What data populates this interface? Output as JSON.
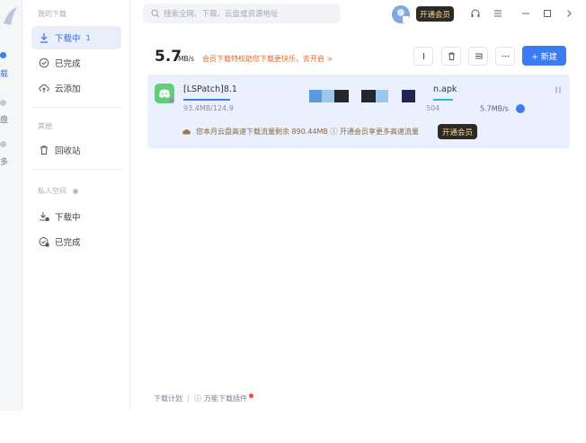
{
  "rail": {
    "items": [
      {
        "label": "载"
      },
      {
        "label": "盘"
      },
      {
        "label": "多"
      }
    ]
  },
  "sidebar": {
    "section_downloads": "我的下载",
    "items": [
      {
        "label": "下载中",
        "count": "1"
      },
      {
        "label": "已完成"
      },
      {
        "label": "云添加"
      }
    ],
    "section_trash": "其他",
    "trash_label": "回收站",
    "section_private": "私人空间",
    "private_items": [
      {
        "label": "下载中"
      },
      {
        "label": "已完成"
      }
    ]
  },
  "topbar": {
    "search_placeholder": "搜索全网、下载、云盘或资源地址",
    "vip_label": "开通会员"
  },
  "header": {
    "speed_value": "5.7",
    "speed_unit": "MB/s",
    "promo_text": "会员下载特权助您下载更快乐，去开启 >",
    "new_label": "+ 新建"
  },
  "task": {
    "name_left": "[LSPatch]8.1",
    "name_right": "n.apk",
    "size_left": "93.4MB/124.9",
    "size_right": "504",
    "speed": "5.7MB/s",
    "progress": 0.75,
    "quota_text": "您本月云盘高速下载流量剩余 890.44MB ⓘ 开通会员享更多高速流量",
    "quota_button": "开通会员"
  },
  "footer": {
    "plan": "下载计划",
    "plugin": "万能下载插件"
  },
  "colors": {
    "accent": "#3b7bf3",
    "vip_bg": "#2d2a25",
    "vip_text": "#f2d59b",
    "promo": "#e06a2c"
  }
}
